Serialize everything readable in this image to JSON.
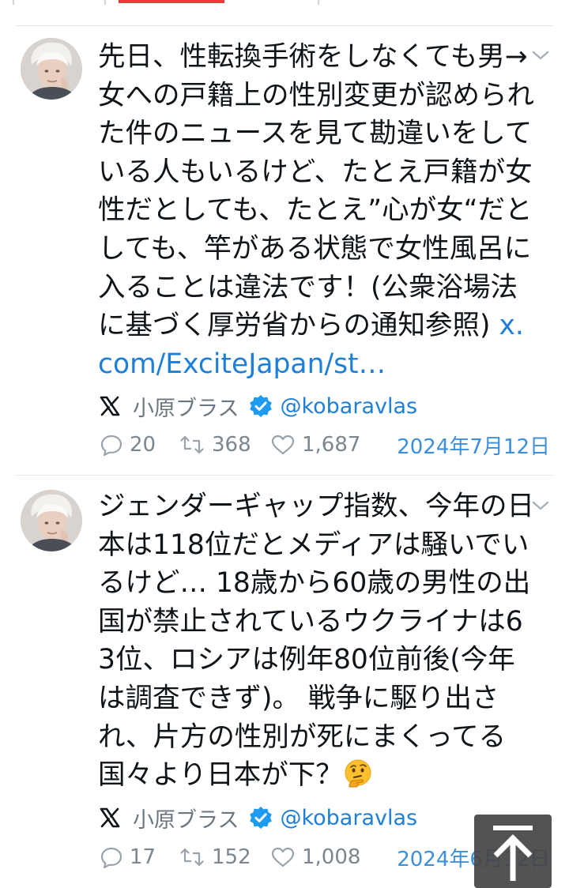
{
  "tweets": [
    {
      "text": "先日、性転換手術をしなくても男→女への戸籍上の性別変更が認められた件のニュースを見て勘違いをしている人もいるけど、たとえ戸籍が女性だとしても、たとえ”心が女“だとしても、竿がある状態で女性風呂に入ることは違法です！(公衆浴場法に基づく厚労省からの通知参照) ",
      "link": "x.com/ExciteJapan/st…",
      "author_name": "小原ブラス",
      "author_handle": "@kobaravlas",
      "replies": "20",
      "retweets": "368",
      "likes": "1,687",
      "date": "2024年7月12日"
    },
    {
      "text": "ジェンダーギャップ指数、今年の日本は118位だとメディアは騒いでいるけど… 18歳から60歳の男性の出国が禁止されているウクライナは63位、ロシアは例年80位前後(今年は調査できず)。 戦争に駆り出され、片方の性別が死にまくってる国々より日本が下？",
      "emoji": "thinking-face-icon",
      "author_name": "小原ブラス",
      "author_handle": "@kobaravlas",
      "replies": "17",
      "retweets": "152",
      "likes": "1,008",
      "date": "2024年6月12日"
    }
  ],
  "colors": {
    "accent": "#1d7fd6",
    "text": "#0f1419",
    "muted": "#6b7680",
    "verified": "#1d9bf0",
    "tab_indicator": "#f23a3a"
  },
  "icons": {
    "menu": "chevron-down-icon",
    "reply": "reply-icon",
    "retweet": "retweet-icon",
    "like": "heart-icon",
    "verified": "verified-badge-icon",
    "platform": "x-logo-icon",
    "scroll_top": "arrow-up-to-top-icon"
  }
}
